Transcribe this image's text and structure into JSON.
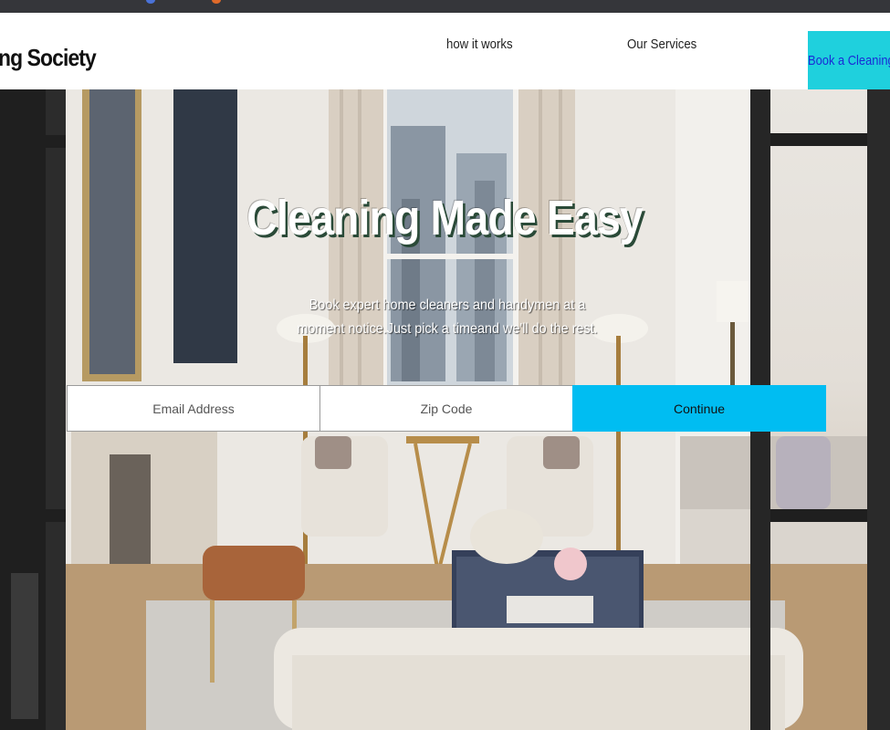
{
  "header": {
    "brand": "ng Society",
    "nav": [
      {
        "label": "how it works"
      },
      {
        "label": "Our Services"
      }
    ],
    "cta_label": "Book a Cleaning"
  },
  "hero": {
    "title": "Cleaning  Made Easy",
    "subtitle": "Book expert home cleaners and handymen at a moment notice.Just pick a timeand we'll do the rest.",
    "email_placeholder": "Email Address",
    "zip_placeholder": "Zip Code",
    "continue_label": "Continue"
  },
  "colors": {
    "cta_background": "#1fd0dd",
    "continue_background": "#00bdf2",
    "browser_bar": "#35363a"
  }
}
